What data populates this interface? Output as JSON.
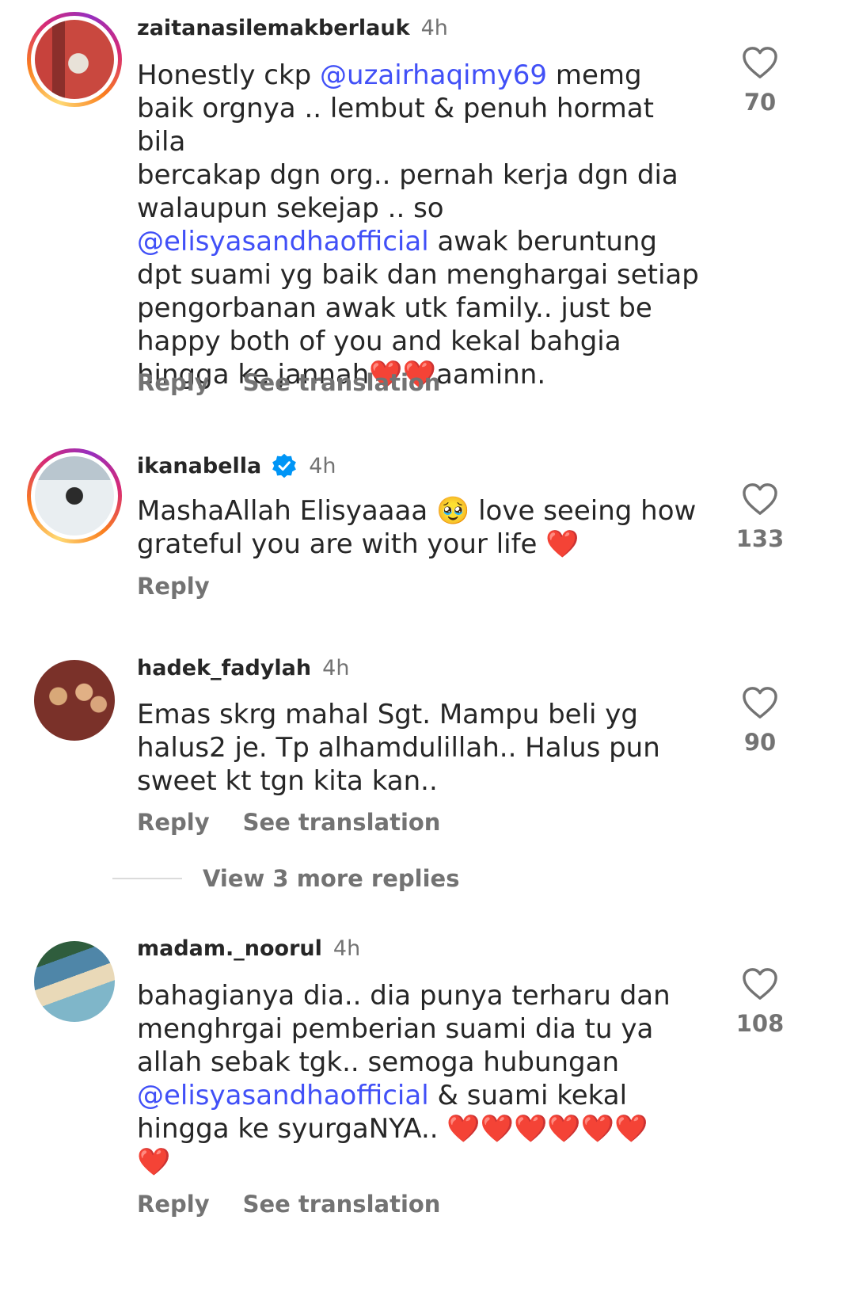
{
  "comments": [
    {
      "username": "zaitanasilemakberlauk",
      "time": "4h",
      "text_parts": [
        {
          "t": "Honestly ckp "
        },
        {
          "t": "@uzairhaqimy69",
          "mention": true
        },
        {
          "t": " memg\nbaik orgnya .. lembut & penuh hormat bila\nbercakap dgn org.. pernah kerja dgn dia\nwalaupun sekejap .. so\n"
        },
        {
          "t": "@elisyasandhaofficial",
          "mention": true
        },
        {
          "t": " awak beruntung\ndpt suami yg baik dan menghargai setiap\npengorbanan awak utk family.. just be\nhappy both of you and kekal bahgia\nhingga ke jannah"
        },
        {
          "t": "❤️❤️",
          "heart": true
        },
        {
          "t": "aaminn."
        }
      ],
      "reply_label": "Reply",
      "translate_label": "See translation",
      "likes": "70"
    },
    {
      "username": "ikanabella",
      "time": "4h",
      "verified": true,
      "text_parts": [
        {
          "t": "MashaAllah Elisyaaaa 🥹 love seeing how\ngrateful you are with your life "
        },
        {
          "t": "❤️",
          "heart": true
        }
      ],
      "reply_label": "Reply",
      "likes": "133"
    },
    {
      "username": "hadek_fadylah",
      "time": "4h",
      "text_parts": [
        {
          "t": "Emas skrg mahal Sgt. Mampu beli yg\nhalus2 je. Tp alhamdulillah.. Halus pun\nsweet kt tgn kita kan.."
        }
      ],
      "reply_label": "Reply",
      "translate_label": "See translation",
      "likes": "90"
    },
    {
      "username": "madam._noorul",
      "time": "4h",
      "text_parts": [
        {
          "t": "bahagianya dia.. dia punya terharu dan\nmenghrgai pemberian suami dia tu ya\nallah sebak tgk.. semoga hubungan\n"
        },
        {
          "t": "@elisyasandhaofficial",
          "mention": true
        },
        {
          "t": " & suami kekal\nhingga ke syurgaNYA.. "
        },
        {
          "t": "❤️❤️❤️❤️❤️❤️\n❤️",
          "heart": true
        }
      ],
      "reply_label": "Reply",
      "translate_label": "See translation",
      "likes": "108"
    }
  ],
  "view_more_replies": "View 3 more replies",
  "colors": {
    "mention": "#4150f7",
    "secondary_text": "#737373",
    "verified_badge": "#0095f6"
  },
  "icons": {
    "like": "heart-outline-icon",
    "verified": "verified-badge-icon"
  }
}
